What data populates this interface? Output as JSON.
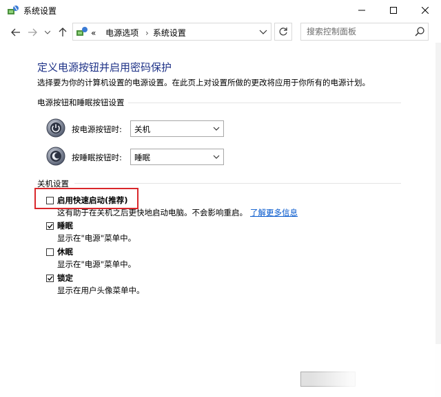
{
  "window": {
    "title": "系统设置",
    "icon": "power-options-icon"
  },
  "nav": {
    "back_icon": "arrow-left-icon",
    "forward_icon": "arrow-right-icon",
    "up_icon": "arrow-up-icon",
    "address": {
      "prefix": "«",
      "crumbs": [
        "电源选项",
        "系统设置"
      ]
    },
    "search": {
      "placeholder": "搜索控制面板"
    }
  },
  "main": {
    "heading": "定义电源按钮并启用密码保护",
    "subtext": "选择要为你的计算机设置的电源设置。在此页上对设置所做的更改将应用于你所有的电源计划。",
    "power_section": {
      "label": "电源按钮和睡眠按钮设置",
      "rows": [
        {
          "label": "按电源按钮时:",
          "value": "关机"
        },
        {
          "label": "按睡眠按钮时:",
          "value": "睡眠"
        }
      ]
    },
    "shutdown_section": {
      "label": "关机设置",
      "options": [
        {
          "label": "启用快速启动(推荐)",
          "checked": false,
          "desc": "这有助于在关机之后更快地启动电脑。不会影响重启。",
          "link": "了解更多信息"
        },
        {
          "label": "睡眠",
          "checked": true,
          "desc": "显示在\"电源\"菜单中。"
        },
        {
          "label": "休眠",
          "checked": false,
          "desc": "显示在\"电源\"菜单中。"
        },
        {
          "label": "锁定",
          "checked": true,
          "desc": "显示在用户头像菜单中。"
        }
      ]
    }
  },
  "colors": {
    "heading": "#1e3287",
    "link": "#0055cc",
    "highlight": "#d9262a"
  }
}
